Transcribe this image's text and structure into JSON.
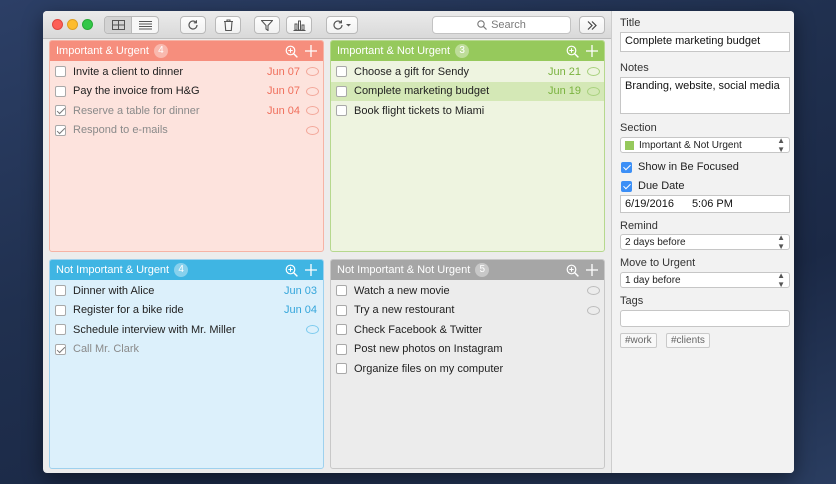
{
  "toolbar": {
    "search_placeholder": "Search"
  },
  "quadrants": [
    {
      "title": "Important & Urgent",
      "count": "4",
      "tasks": [
        {
          "title": "Invite a client to dinner",
          "due": "Jun 07",
          "done": false
        },
        {
          "title": "Pay the invoice from H&G",
          "due": "Jun 07",
          "done": false
        },
        {
          "title": "Reserve a table for dinner",
          "due": "Jun 04",
          "done": true
        },
        {
          "title": "Respond to e-mails",
          "due": "",
          "done": true
        }
      ]
    },
    {
      "title": "Important & Not Urgent",
      "count": "3",
      "tasks": [
        {
          "title": "Choose a gift for Sendy",
          "due": "Jun 21",
          "done": false
        },
        {
          "title": "Complete marketing budget",
          "due": "Jun 19",
          "done": false
        },
        {
          "title": "Book flight tickets to Miami",
          "due": "",
          "done": false
        }
      ]
    },
    {
      "title": "Not Important & Urgent",
      "count": "4",
      "tasks": [
        {
          "title": "Dinner with Alice",
          "due": "Jun 03",
          "done": false
        },
        {
          "title": "Register for a bike ride",
          "due": "Jun 04",
          "done": false
        },
        {
          "title": "Schedule interview with Mr. Miller",
          "due": "",
          "done": false
        },
        {
          "title": "Call Mr. Clark",
          "due": "",
          "done": true
        }
      ]
    },
    {
      "title": "Not Important & Not Urgent",
      "count": "5",
      "tasks": [
        {
          "title": "Watch a new movie",
          "due": "",
          "done": false
        },
        {
          "title": "Try a new restourant",
          "due": "",
          "done": false
        },
        {
          "title": "Check Facebook & Twitter",
          "due": "",
          "done": false
        },
        {
          "title": "Post new photos on Instagram",
          "due": "",
          "done": false
        },
        {
          "title": "Organize files on my computer",
          "due": "",
          "done": false
        }
      ]
    }
  ],
  "inspector": {
    "title_label": "Title",
    "title_value": "Complete marketing budget",
    "notes_label": "Notes",
    "notes_value": "Branding, website, social media",
    "section_label": "Section",
    "section_value": "Important & Not Urgent",
    "show_focused_label": "Show in Be Focused",
    "due_date_label": "Due Date",
    "due_date_value": "6/19/2016",
    "due_time_value": "5:06 PM",
    "remind_label": "Remind",
    "remind_value": "2 days before",
    "move_label": "Move to Urgent",
    "move_value": "1 day before",
    "tags_label": "Tags",
    "tags": [
      "#work",
      "#clients"
    ]
  },
  "colors": {
    "urgent_important": "#f68e7d",
    "important_not_urgent": "#96c95c",
    "urgent_not_important": "#3fb5e3",
    "neither": "#a6a6a6",
    "check_accent": "#3c8ff6"
  }
}
